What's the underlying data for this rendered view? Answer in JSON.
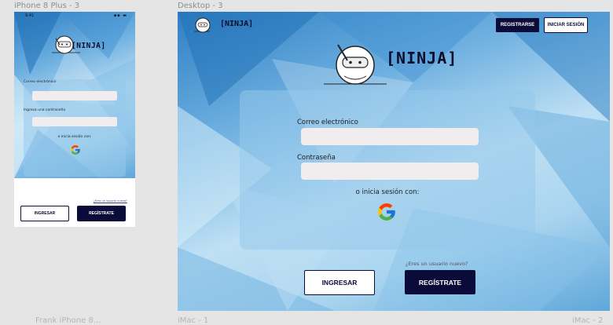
{
  "frames": {
    "phone_label": "iPhone 8 Plus - 3",
    "desktop_label": "Desktop - 3",
    "bottom_labels": [
      "Frank iPhone 8...",
      "iMac - 1",
      "iMac - 2"
    ]
  },
  "brand": {
    "name": "[NINJA]",
    "icon": "ninja-logo-icon"
  },
  "phone": {
    "email_label": "Correo electrónico",
    "password_label": "Ingresa una contraseña",
    "social_text": "o inicia sesión con:",
    "new_user_text": "¿Eres un usuario nuevo?",
    "ingresar_label": "INGRESAR",
    "registrate_label": "REGÍSTRATE"
  },
  "desktop": {
    "nav_registrarse": "REGISTRARSE",
    "nav_iniciar": "INICIAR SESIÓN",
    "email_label": "Correo electrónico",
    "password_label": "Contraseña",
    "social_text": "o inicia sesión con:",
    "new_user_text": "¿Eres un usuario nuevo?",
    "ingresar_label": "INGRESAR",
    "registrate_label": "REGÍSTRATE"
  },
  "colors": {
    "navy": "#0b0b3a",
    "input_bg": "#f1ecee",
    "card": "#96c8eb"
  }
}
